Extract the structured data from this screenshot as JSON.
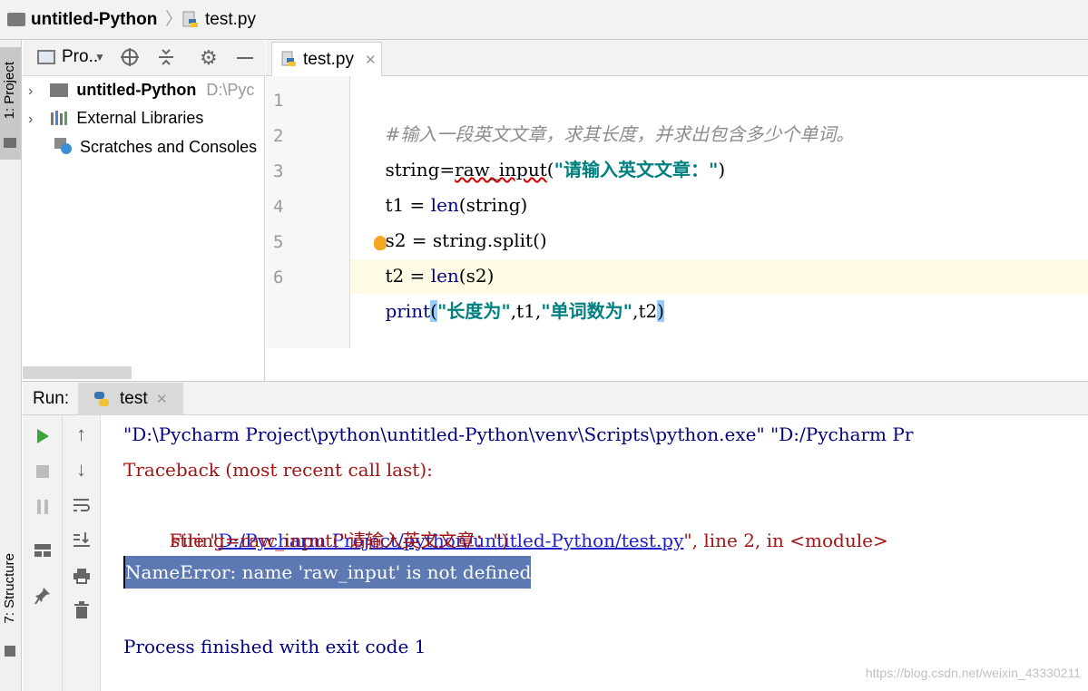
{
  "breadcrumb": {
    "project": "untitled-Python",
    "file": "test.py"
  },
  "tool_windows": {
    "project_tab": "1: Project",
    "structure_tab": "7: Structure"
  },
  "project_panel": {
    "view_selector": "Pro..",
    "tree": [
      {
        "label": "untitled-Python",
        "path": "D:\\Pyc"
      },
      {
        "label": "External Libraries"
      },
      {
        "label": "Scratches and Consoles"
      }
    ]
  },
  "editor": {
    "tab_label": "test.py",
    "line_numbers": [
      "1",
      "2",
      "3",
      "4",
      "5",
      "6"
    ],
    "lines": {
      "l1": "#输入一段英文文章，求其长度，并求出包含多少个单词。",
      "l2a": "string=",
      "l2b": "raw_input",
      "l2c": "(",
      "l2d": "\"请输入英文文章：\"",
      "l2e": ")",
      "l3a": "t1 = ",
      "l3b": "len",
      "l3c": "(string)",
      "l4": "s2 = string.split()",
      "l5a": "t2 = ",
      "l5b": "len",
      "l5c": "(s2)",
      "l6a": "print",
      "l6b": "(",
      "l6c": "\"长度为\"",
      "l6d": ",t1,",
      "l6e": "\"单词数为\"",
      "l6f": ",t2",
      "l6g": ")"
    }
  },
  "run": {
    "label": "Run:",
    "tab": "test",
    "output": {
      "cmd": "\"D:\\Pycharm Project\\python\\untitled-Python\\venv\\Scripts\\python.exe\" \"D:/Pycharm Pr",
      "traceback": "Traceback (most recent call last):",
      "file_prefix": "File \"",
      "file_link": "D:/Pycharm Project/python/untitled-Python/test.py",
      "file_suffix": "\", line 2, in <module>",
      "source_line": "string=raw_input(\"请输入英文文章：\")",
      "error": "NameError: name 'raw_input' is not defined",
      "exit": "Process finished with exit code 1"
    }
  },
  "watermark": "https://blog.csdn.net/weixin_43330211",
  "colors": {
    "keyword": "#000080",
    "string": "#008080",
    "error_text": "#a31515",
    "error_highlight": "#5c79b3",
    "link": "#2020cc",
    "current_line": "#fffae3"
  }
}
